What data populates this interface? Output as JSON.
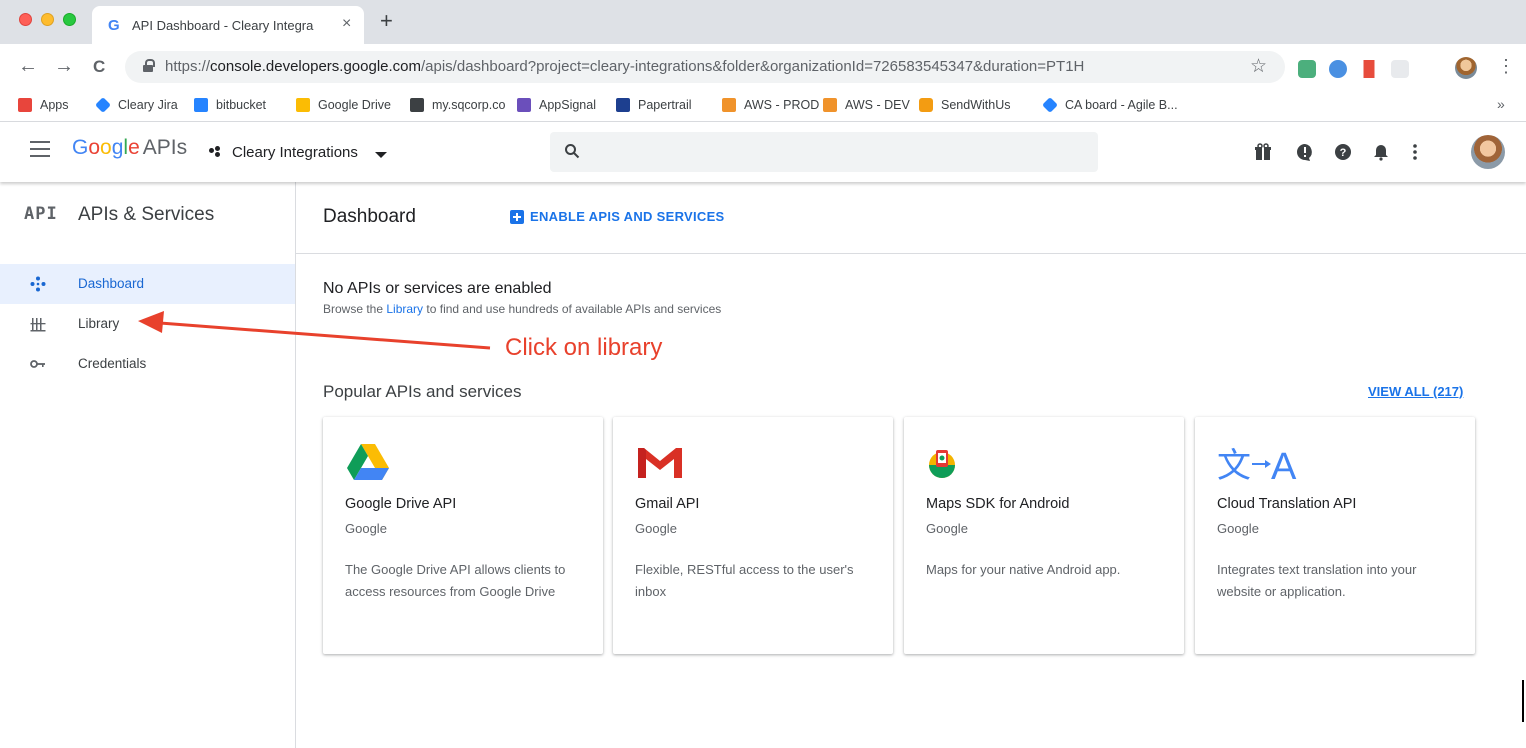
{
  "browser": {
    "tab_title": "API Dashboard - Cleary Integra",
    "tab_favicon": "G",
    "tab_close": "×",
    "new_tab": "+",
    "back": "←",
    "forward": "→",
    "reload": "C",
    "url_scheme": "https://",
    "url_host": "console.developers.google.com",
    "url_path": "/apis/dashboard?project=cleary-integrations&folder&organizationId=726583545347&duration=PT1H",
    "star": "☆",
    "menu": "⋮",
    "bookmarks_more": "»",
    "bookmarks": [
      {
        "label": "Apps",
        "icon": "apps-grid-icon",
        "color": "#e8453c"
      },
      {
        "label": "Cleary Jira",
        "icon": "jira-icon",
        "color": "#2684ff"
      },
      {
        "label": "bitbucket",
        "icon": "bitbucket-icon",
        "color": "#2684ff"
      },
      {
        "label": "Google Drive",
        "icon": "google-drive-icon",
        "color": "#fbbc04"
      },
      {
        "label": "my.sqcorp.co",
        "icon": "square-icon",
        "color": "#3c4043"
      },
      {
        "label": "AppSignal",
        "icon": "appsignal-icon",
        "color": "#6b4fbb"
      },
      {
        "label": "Papertrail",
        "icon": "papertrail-icon",
        "color": "#1d3f8f"
      },
      {
        "label": "AWS - PROD",
        "icon": "aws-cube-icon",
        "color": "#f0932b"
      },
      {
        "label": "AWS - DEV",
        "icon": "aws-cube-icon",
        "color": "#f0932b"
      },
      {
        "label": "SendWithUs",
        "icon": "sendwithus-icon",
        "color": "#f39c12"
      },
      {
        "label": "CA board - Agile B...",
        "icon": "jira-icon",
        "color": "#2684ff"
      }
    ]
  },
  "header": {
    "logo_google": "Google",
    "logo_apis": "APIs",
    "project_name": "Cleary Integrations"
  },
  "sidebar": {
    "badge": "API",
    "title": "APIs & Services",
    "items": [
      {
        "label": "Dashboard",
        "icon": "dashboard-icon",
        "active": true
      },
      {
        "label": "Library",
        "icon": "library-icon",
        "active": false
      },
      {
        "label": "Credentials",
        "icon": "key-icon",
        "active": false
      }
    ]
  },
  "main": {
    "title": "Dashboard",
    "enable_label": "ENABLE APIS AND SERVICES",
    "empty_title": "No APIs or services are enabled",
    "empty_desc_before": "Browse the ",
    "empty_desc_link": "Library",
    "empty_desc_after": " to find and use hundreds of available APIs and services",
    "popular_title": "Popular APIs and services",
    "view_all": "VIEW ALL (217)",
    "cards": [
      {
        "title": "Google Drive API",
        "vendor": "Google",
        "desc": "The Google Drive API allows clients to access resources from Google Drive",
        "icon": "google-drive-logo-icon"
      },
      {
        "title": "Gmail API",
        "vendor": "Google",
        "desc": "Flexible, RESTful access to the user's inbox",
        "icon": "gmail-logo-icon"
      },
      {
        "title": "Maps SDK for Android",
        "vendor": "Google",
        "desc": "Maps for your native Android app.",
        "icon": "maps-android-logo-icon"
      },
      {
        "title": "Cloud Translation API",
        "vendor": "Google",
        "desc": "Integrates text translation into your website or application.",
        "icon": "translate-logo-icon"
      }
    ]
  },
  "annotation": {
    "text": "Click on library",
    "color": "#e8412c"
  }
}
